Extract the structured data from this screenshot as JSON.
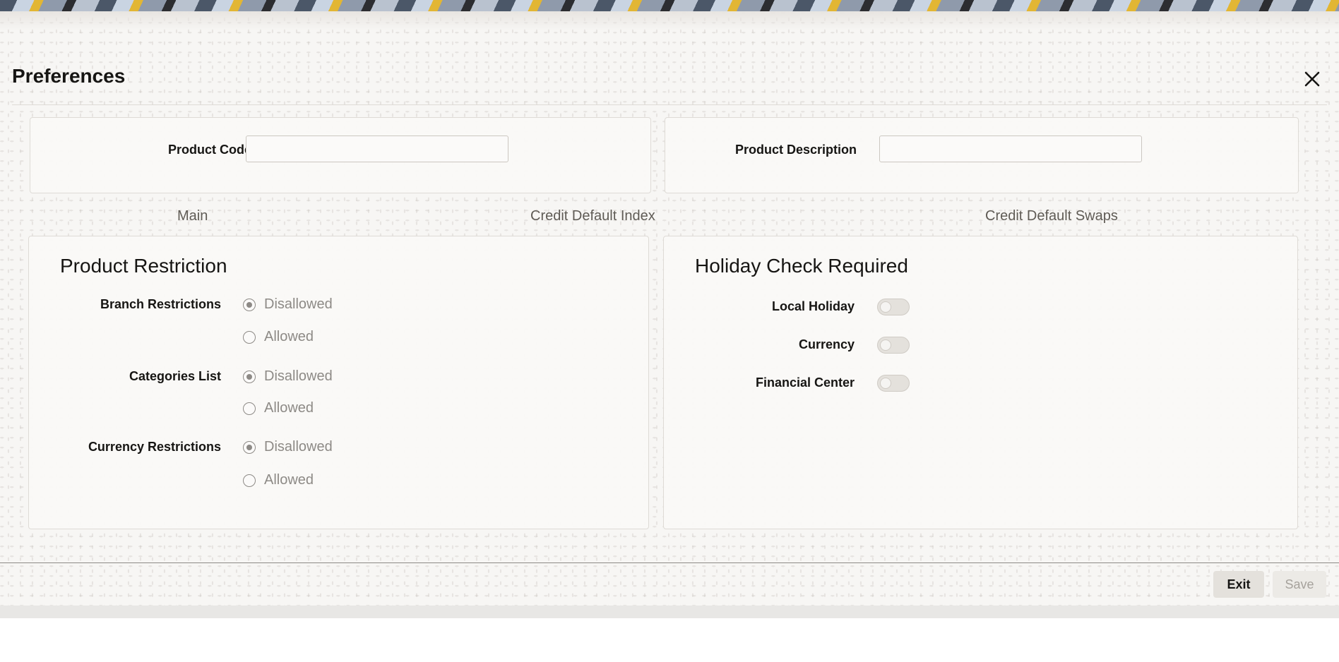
{
  "window": {
    "title": "Preferences",
    "close_icon": "close-icon"
  },
  "header": {
    "product_code_label": "Product Code",
    "product_code_value": "",
    "product_description_label": "Product Description",
    "product_description_value": ""
  },
  "tabs": [
    {
      "label": "Main"
    },
    {
      "label": "Credit Default Index"
    },
    {
      "label": "Credit Default Swaps"
    }
  ],
  "product_restriction": {
    "title": "Product Restriction",
    "groups": [
      {
        "label": "Branch Restrictions",
        "options": [
          {
            "label": "Disallowed",
            "checked": true
          },
          {
            "label": "Allowed",
            "checked": false
          }
        ]
      },
      {
        "label": "Categories List",
        "options": [
          {
            "label": "Disallowed",
            "checked": true
          },
          {
            "label": "Allowed",
            "checked": false
          }
        ]
      },
      {
        "label": "Currency Restrictions",
        "options": [
          {
            "label": "Disallowed",
            "checked": true
          },
          {
            "label": "Allowed",
            "checked": false
          }
        ]
      }
    ]
  },
  "holiday_check": {
    "title": "Holiday Check Required",
    "items": [
      {
        "label": "Local Holiday",
        "enabled": false
      },
      {
        "label": "Currency",
        "enabled": false
      },
      {
        "label": "Financial Center",
        "enabled": false
      }
    ]
  },
  "footer": {
    "exit_label": "Exit",
    "save_label": "Save"
  },
  "colors": {
    "background": "#f7f6f4",
    "card": "#faf9f7",
    "muted_text": "#8d8a86",
    "tab_text": "#5f5b55"
  }
}
